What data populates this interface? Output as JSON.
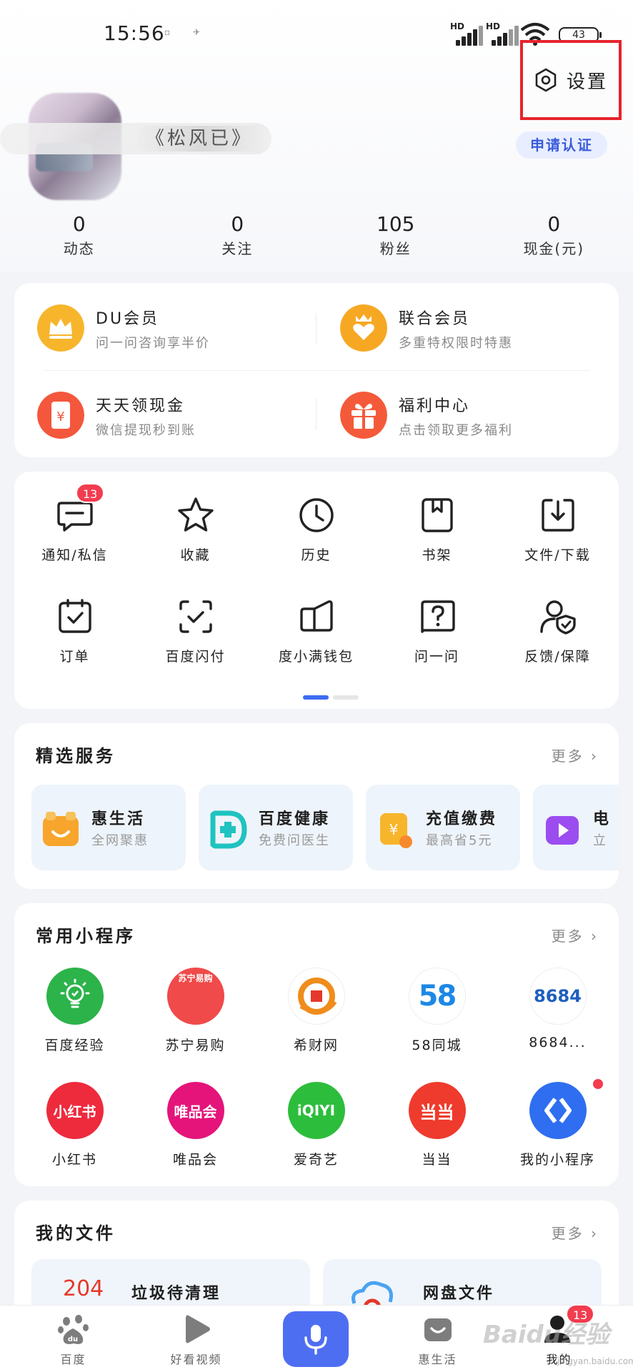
{
  "status_bar": {
    "time": "15:56",
    "battery": "43"
  },
  "header": {
    "settings_label": "设置",
    "username": "《松风已》",
    "apply_label": "申请认证"
  },
  "stats": [
    {
      "num": "0",
      "label": "动态"
    },
    {
      "num": "0",
      "label": "关注"
    },
    {
      "num": "105",
      "label": "粉丝"
    },
    {
      "num": "0",
      "label": "现金(元)"
    }
  ],
  "membership": [
    {
      "title": "DU会员",
      "sub": "问一问咨询享半价",
      "icon": "crown-icon",
      "color": "#f7b52c"
    },
    {
      "title": "联合会员",
      "sub": "多重特权限时特惠",
      "icon": "heart-crown-icon",
      "color": "#f7a823"
    },
    {
      "title": "天天领现金",
      "sub": "微信提现秒到账",
      "icon": "cash-icon",
      "color": "#f4573c"
    },
    {
      "title": "福利中心",
      "sub": "点击领取更多福利",
      "icon": "gift-icon",
      "color": "#f45a3a"
    }
  ],
  "functions": [
    {
      "label": "通知/私信",
      "icon": "message-icon",
      "badge": "13"
    },
    {
      "label": "收藏",
      "icon": "star-icon"
    },
    {
      "label": "历史",
      "icon": "clock-icon"
    },
    {
      "label": "书架",
      "icon": "bookshelf-icon"
    },
    {
      "label": "文件/下载",
      "icon": "download-icon"
    },
    {
      "label": "订单",
      "icon": "order-icon"
    },
    {
      "label": "百度闪付",
      "icon": "scan-pay-icon"
    },
    {
      "label": "度小满钱包",
      "icon": "wallet-icon"
    },
    {
      "label": "问一问",
      "icon": "question-icon"
    },
    {
      "label": "反馈/保障",
      "icon": "feedback-shield-icon"
    }
  ],
  "services": {
    "title": "精选服务",
    "more": "更多",
    "items": [
      {
        "title": "惠生活",
        "sub": "全网聚惠",
        "color": "#f7a52c"
      },
      {
        "title": "百度健康",
        "sub": "免费问医生",
        "color": "#1fc3c0"
      },
      {
        "title": "充值缴费",
        "sub": "最高省5元",
        "color": "#f7b52c"
      },
      {
        "title": "电",
        "sub": "立",
        "color": "#9b4df0"
      }
    ]
  },
  "mini_programs": {
    "title": "常用小程序",
    "more": "更多",
    "items": [
      {
        "label": "百度经验",
        "color": "#2cb34a",
        "icon_text": ""
      },
      {
        "label": "苏宁易购",
        "color": "#f04a4a",
        "icon_text": "苏宁易购"
      },
      {
        "label": "希财网",
        "color": "#ffffff",
        "icon_text": ""
      },
      {
        "label": "58同城",
        "color": "#ffffff",
        "icon_text": "58"
      },
      {
        "label": "8684...",
        "color": "#ffffff",
        "icon_text": "8684"
      },
      {
        "label": "小红书",
        "color": "#ee2a3d",
        "icon_text": "小红书"
      },
      {
        "label": "唯品会",
        "color": "#e5147a",
        "icon_text": "唯品会"
      },
      {
        "label": "爱奇艺",
        "color": "#2dbd3c",
        "icon_text": "iQIYI"
      },
      {
        "label": "当当",
        "color": "#ef3b2d",
        "icon_text": "当当"
      },
      {
        "label": "我的小程序",
        "color": "#2f6ef0",
        "icon_text": ""
      }
    ]
  },
  "files": {
    "title": "我的文件",
    "more": "更多",
    "items": [
      {
        "count": "204",
        "title": "垃圾待清理"
      },
      {
        "title": "网盘文件"
      }
    ]
  },
  "nav": [
    {
      "label": "百度",
      "icon": "paw-icon"
    },
    {
      "label": "好看视频",
      "icon": "play-icon"
    },
    {
      "label": "惠生活",
      "icon": "smile-bag-icon"
    },
    {
      "label": "我的",
      "icon": "user-icon",
      "badge": "13"
    }
  ],
  "watermark": {
    "text": "Baidu经验",
    "sub": "jingyan.baidu.com"
  }
}
